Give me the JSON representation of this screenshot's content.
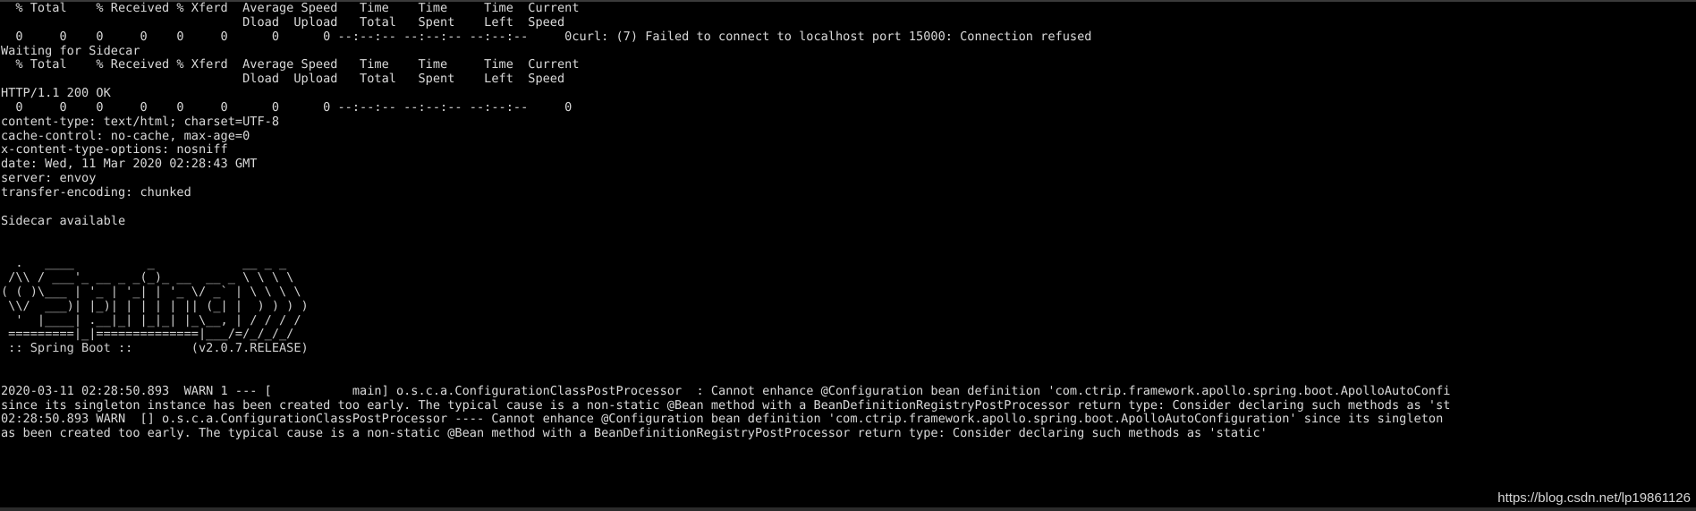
{
  "terminal": {
    "background_color": "#000000",
    "foreground_color": "#d9d9d9",
    "watermark": "https://blog.csdn.net/lp19861126",
    "curl_progress_header_line1": "  % Total    % Received % Xferd  Average Speed   Time    Time     Time  Current",
    "curl_progress_header_line2": "                                 Dload  Upload   Total   Spent    Left  Speed",
    "curl_attempt_1_progress": "  0     0    0     0    0     0      0      0 --:--:-- --:--:-- --:--:--     0curl: (7) Failed to connect to localhost port 15000: Connection refused",
    "waiting_message": "Waiting for Sidecar",
    "curl_progress_header2_line1": "  % Total    % Received % Xferd  Average Speed   Time    Time     Time  Current",
    "curl_progress_header2_line2": "                                 Dload  Upload   Total   Spent    Left  Speed",
    "http_status_line": "HTTP/1.1 200 OK",
    "curl_attempt_2_progress": "  0     0    0     0    0     0      0      0 --:--:-- --:--:-- --:--:--     0",
    "http_headers": [
      "content-type: text/html; charset=UTF-8",
      "cache-control: no-cache, max-age=0",
      "x-content-type-options: nosniff",
      "date: Wed, 11 Mar 2020 02:28:43 GMT",
      "server: envoy",
      "transfer-encoding: chunked"
    ],
    "sidecar_available_message": "Sidecar available",
    "spring_boot_banner": [
      "  .   ____          _            __ _ _",
      " /\\\\ / ___'_ __ _ _(_)_ __  __ _ \\ \\ \\ \\",
      "( ( )\\___ | '_ | '_| | '_ \\/ _` | \\ \\ \\ \\",
      " \\\\/  ___)| |_)| | | | | || (_| |  ) ) ) )",
      "  '  |____| .__|_| |_|_| |_\\__, | / / / /",
      " =========|_|==============|___/=/_/_/_/"
    ],
    "spring_boot_tagline": " :: Spring Boot ::        (v2.0.7.RELEASE)",
    "log_lines": [
      "2020-03-11 02:28:50.893  WARN 1 --- [           main] o.s.c.a.ConfigurationClassPostProcessor  : Cannot enhance @Configuration bean definition 'com.ctrip.framework.apollo.spring.boot.ApolloAutoConfi",
      "since its singleton instance has been created too early. The typical cause is a non-static @Bean method with a BeanDefinitionRegistryPostProcessor return type: Consider declaring such methods as 'st",
      "02:28:50.893 WARN  [] o.s.c.a.ConfigurationClassPostProcessor ---- Cannot enhance @Configuration bean definition 'com.ctrip.framework.apollo.spring.boot.ApolloAutoConfiguration' since its singleton",
      "as been created too early. The typical cause is a non-static @Bean method with a BeanDefinitionRegistryPostProcessor return type: Consider declaring such methods as 'static'"
    ]
  }
}
